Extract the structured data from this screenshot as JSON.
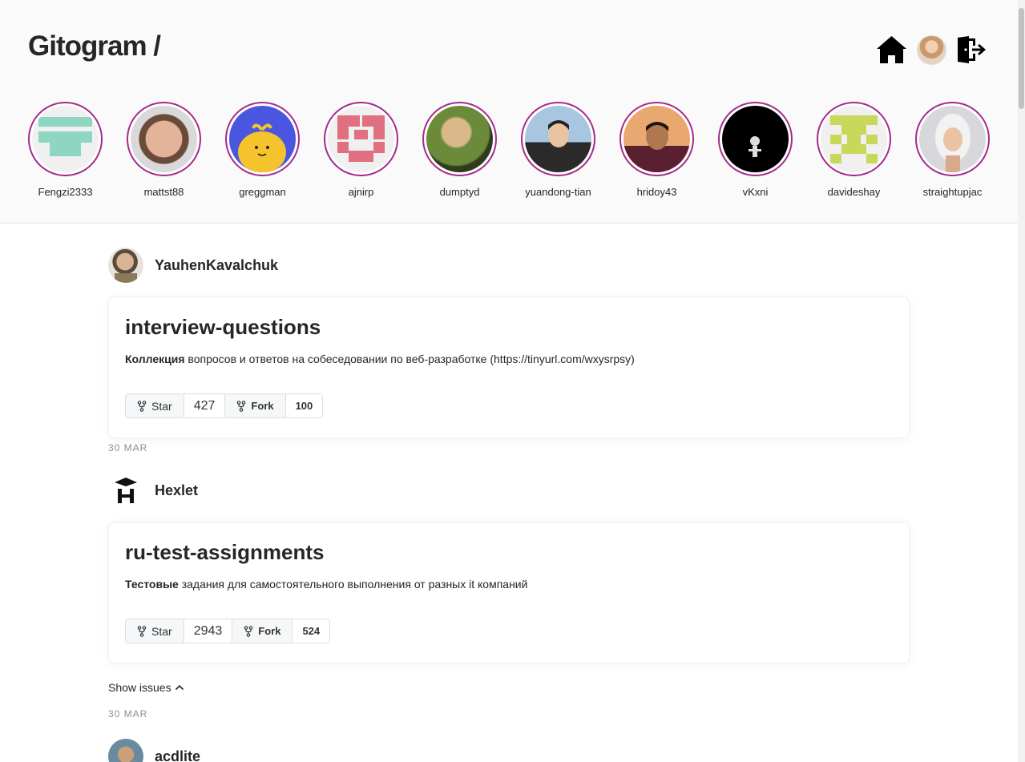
{
  "app": {
    "title": "Gitogram /"
  },
  "stories": [
    {
      "name": "Fengzi2333"
    },
    {
      "name": "mattst88"
    },
    {
      "name": "greggman"
    },
    {
      "name": "ajnirp"
    },
    {
      "name": "dumptyd"
    },
    {
      "name": "yuandong-tian"
    },
    {
      "name": "hridoy43"
    },
    {
      "name": "vKxni"
    },
    {
      "name": "davideshay"
    },
    {
      "name": "straightupjac"
    }
  ],
  "feed": [
    {
      "author": "YauhenKavalchuk",
      "repo": "interview-questions",
      "desc_bold": "Коллекция",
      "desc_rest": " вопросов и ответов на собеседовании по веб-разработке (https://tinyurl.com/wxysrpsy)",
      "star_label": "Star",
      "stars": "427",
      "fork_label": "Fork",
      "forks": "100",
      "date": "30 MAR"
    },
    {
      "author": "Hexlet",
      "repo": "ru-test-assignments",
      "desc_bold": "Тестовые",
      "desc_rest": " задания для самостоятельного выполнения от разных it компаний",
      "star_label": "Star",
      "stars": "2943",
      "fork_label": "Fork",
      "forks": "524",
      "show_issues": "Show issues",
      "date": "30 MAR"
    },
    {
      "author": "acdlite"
    }
  ],
  "colors": {
    "story_ring": "#a52a8a",
    "header_bg": "#fafafa"
  }
}
